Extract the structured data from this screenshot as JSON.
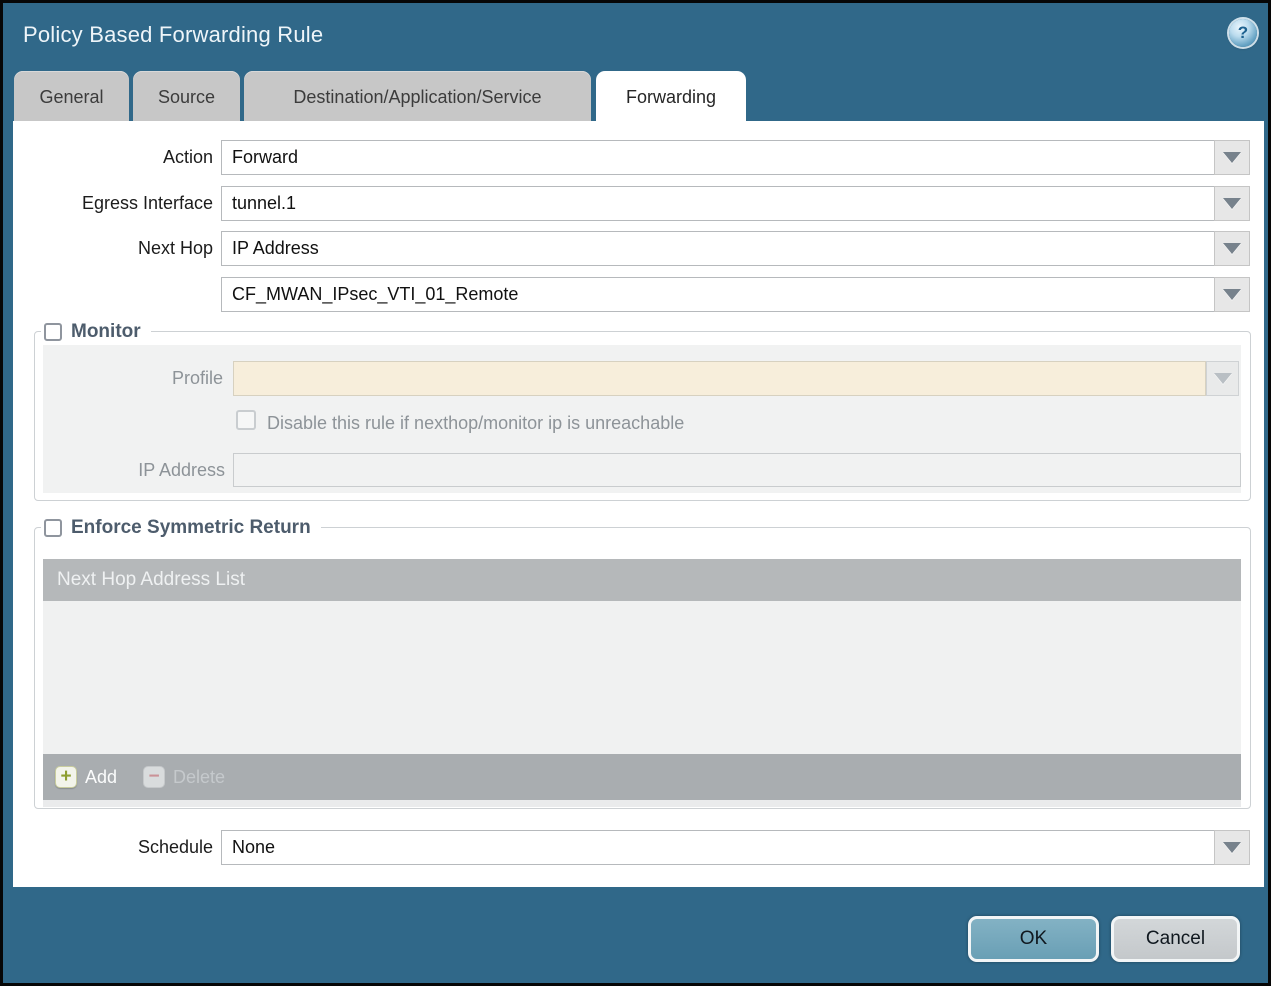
{
  "window": {
    "title": "Policy Based Forwarding Rule",
    "help_icon_glyph": "?"
  },
  "tabs": [
    {
      "label": "General",
      "active": false
    },
    {
      "label": "Source",
      "active": false
    },
    {
      "label": "Destination/Application/Service",
      "active": false
    },
    {
      "label": "Forwarding",
      "active": true
    }
  ],
  "fields": {
    "action": {
      "label": "Action",
      "value": "Forward"
    },
    "egress_interface": {
      "label": "Egress Interface",
      "value": "tunnel.1"
    },
    "next_hop": {
      "label": "Next Hop",
      "value": "IP Address"
    },
    "next_hop_address": {
      "value": "CF_MWAN_IPsec_VTI_01_Remote"
    },
    "schedule": {
      "label": "Schedule",
      "value": "None"
    }
  },
  "monitor_section": {
    "title": "Monitor",
    "checked": false,
    "profile": {
      "label": "Profile",
      "value": ""
    },
    "disable_rule": {
      "label": "Disable this rule if nexthop/monitor ip is unreachable",
      "checked": false
    },
    "ip_address": {
      "label": "IP Address",
      "value": ""
    }
  },
  "symmetric_return_section": {
    "title": "Enforce Symmetric Return",
    "checked": false,
    "list_header": "Next Hop Address List",
    "rows": [],
    "add_button": {
      "label": "Add",
      "icon_glyph": "+",
      "disabled": false
    },
    "delete_button": {
      "label": "Delete",
      "icon_glyph": "−",
      "disabled": true
    }
  },
  "dialog_buttons": {
    "ok": "OK",
    "cancel": "Cancel"
  },
  "colors": {
    "titlebar": "#306889",
    "tab_inactive": "#c7c7c7",
    "tab_active": "#ffffff",
    "section_title": "#4d5c6c",
    "disabled_field_bg": "#f7eedb",
    "panel_bg": "#f1f2f2",
    "list_header_bg": "#b5b8ba",
    "list_footer_bg": "#a9adb0",
    "ok_button": "#74a8bc",
    "cancel_button": "#cbcfd2"
  }
}
